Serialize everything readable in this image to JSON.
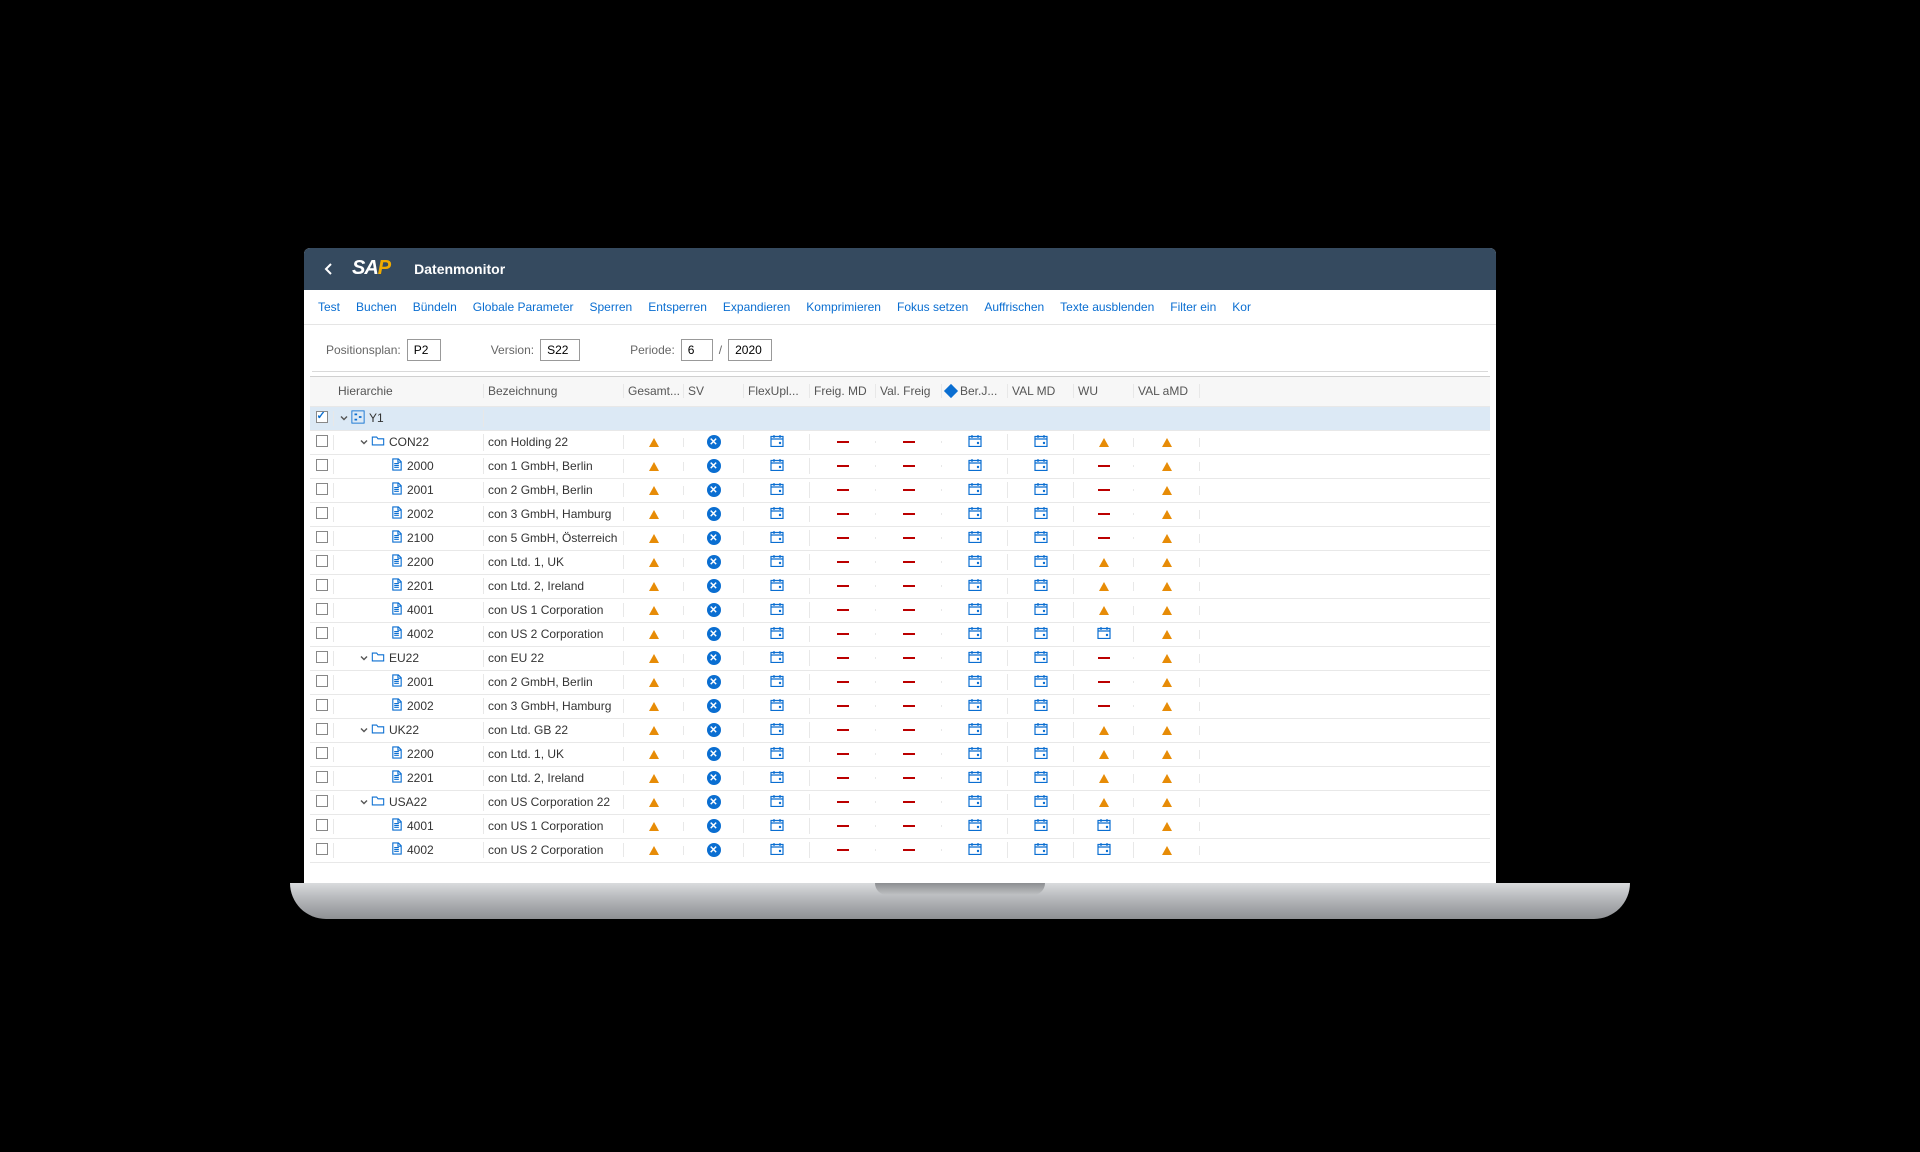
{
  "header": {
    "title": "Datenmonitor",
    "logo": "SAP"
  },
  "toolbar": [
    "Test",
    "Buchen",
    "Bündeln",
    "Globale Parameter",
    "Sperren",
    "Entsperren",
    "Expandieren",
    "Komprimieren",
    "Fokus setzen",
    "Auffrischen",
    "Texte ausblenden",
    "Filter ein",
    "Kor"
  ],
  "filters": {
    "positionsplan_label": "Positionsplan:",
    "positionsplan": "P2",
    "version_label": "Version:",
    "version": "S22",
    "periode_label": "Periode:",
    "periode_m": "6",
    "periode_y": "2020"
  },
  "columns": [
    "Hierarchie",
    "Bezeichnung",
    "Gesamt...",
    "SV",
    "FlexUpl...",
    "Freig. MD",
    "Val. Freig",
    "Ber.J...",
    "VAL MD",
    "WU",
    "VAL aMD"
  ],
  "rows": [
    {
      "lvl": 0,
      "chk": true,
      "exp": true,
      "ico": "tree",
      "code": "Y1",
      "bez": "",
      "g": "",
      "sv": "",
      "fu": "",
      "fm": "",
      "vf": "",
      "bj": "",
      "vm": "",
      "wu": "",
      "va": ""
    },
    {
      "lvl": 1,
      "chk": false,
      "exp": true,
      "ico": "folder",
      "code": "CON22",
      "bez": "con Holding 22",
      "g": "tri",
      "sv": "x",
      "fu": "cal",
      "fm": "dash",
      "vf": "dash",
      "bj": "cal",
      "vm": "cal",
      "wu": "tri",
      "va": "tri"
    },
    {
      "lvl": 2,
      "chk": false,
      "exp": false,
      "ico": "doc",
      "code": "2000",
      "bez": "con 1 GmbH, Berlin",
      "g": "tri",
      "sv": "x",
      "fu": "cal",
      "fm": "dash",
      "vf": "dash",
      "bj": "cal",
      "vm": "cal",
      "wu": "dash",
      "va": "tri"
    },
    {
      "lvl": 2,
      "chk": false,
      "exp": false,
      "ico": "doc",
      "code": "2001",
      "bez": "con 2 GmbH, Berlin",
      "g": "tri",
      "sv": "x",
      "fu": "cal",
      "fm": "dash",
      "vf": "dash",
      "bj": "cal",
      "vm": "cal",
      "wu": "dash",
      "va": "tri"
    },
    {
      "lvl": 2,
      "chk": false,
      "exp": false,
      "ico": "doc",
      "code": "2002",
      "bez": "con 3 GmbH, Hamburg",
      "g": "tri",
      "sv": "x",
      "fu": "cal",
      "fm": "dash",
      "vf": "dash",
      "bj": "cal",
      "vm": "cal",
      "wu": "dash",
      "va": "tri"
    },
    {
      "lvl": 2,
      "chk": false,
      "exp": false,
      "ico": "doc",
      "code": "2100",
      "bez": "con 5 GmbH, Österreich",
      "g": "tri",
      "sv": "x",
      "fu": "cal",
      "fm": "dash",
      "vf": "dash",
      "bj": "cal",
      "vm": "cal",
      "wu": "dash",
      "va": "tri"
    },
    {
      "lvl": 2,
      "chk": false,
      "exp": false,
      "ico": "doc",
      "code": "2200",
      "bez": "con Ltd. 1, UK",
      "g": "tri",
      "sv": "x",
      "fu": "cal",
      "fm": "dash",
      "vf": "dash",
      "bj": "cal",
      "vm": "cal",
      "wu": "tri",
      "va": "tri"
    },
    {
      "lvl": 2,
      "chk": false,
      "exp": false,
      "ico": "doc",
      "code": "2201",
      "bez": "con Ltd. 2, Ireland",
      "g": "tri",
      "sv": "x",
      "fu": "cal",
      "fm": "dash",
      "vf": "dash",
      "bj": "cal",
      "vm": "cal",
      "wu": "tri",
      "va": "tri"
    },
    {
      "lvl": 2,
      "chk": false,
      "exp": false,
      "ico": "doc",
      "code": "4001",
      "bez": "con US 1 Corporation",
      "g": "tri",
      "sv": "x",
      "fu": "cal",
      "fm": "dash",
      "vf": "dash",
      "bj": "cal",
      "vm": "cal",
      "wu": "tri",
      "va": "tri"
    },
    {
      "lvl": 2,
      "chk": false,
      "exp": false,
      "ico": "doc",
      "code": "4002",
      "bez": "con US 2 Corporation",
      "g": "tri",
      "sv": "x",
      "fu": "cal",
      "fm": "dash",
      "vf": "dash",
      "bj": "cal",
      "vm": "cal",
      "wu": "cal",
      "va": "tri"
    },
    {
      "lvl": 1,
      "chk": false,
      "exp": true,
      "ico": "folder",
      "code": "EU22",
      "bez": "con EU 22",
      "g": "tri",
      "sv": "x",
      "fu": "cal",
      "fm": "dash",
      "vf": "dash",
      "bj": "cal",
      "vm": "cal",
      "wu": "dash",
      "va": "tri"
    },
    {
      "lvl": 2,
      "chk": false,
      "exp": false,
      "ico": "doc",
      "code": "2001",
      "bez": "con 2 GmbH, Berlin",
      "g": "tri",
      "sv": "x",
      "fu": "cal",
      "fm": "dash",
      "vf": "dash",
      "bj": "cal",
      "vm": "cal",
      "wu": "dash",
      "va": "tri"
    },
    {
      "lvl": 2,
      "chk": false,
      "exp": false,
      "ico": "doc",
      "code": "2002",
      "bez": "con 3 GmbH, Hamburg",
      "g": "tri",
      "sv": "x",
      "fu": "cal",
      "fm": "dash",
      "vf": "dash",
      "bj": "cal",
      "vm": "cal",
      "wu": "dash",
      "va": "tri"
    },
    {
      "lvl": 1,
      "chk": false,
      "exp": true,
      "ico": "folder",
      "code": "UK22",
      "bez": "con Ltd. GB 22",
      "g": "tri",
      "sv": "x",
      "fu": "cal",
      "fm": "dash",
      "vf": "dash",
      "bj": "cal",
      "vm": "cal",
      "wu": "tri",
      "va": "tri"
    },
    {
      "lvl": 2,
      "chk": false,
      "exp": false,
      "ico": "doc",
      "code": "2200",
      "bez": "con Ltd. 1, UK",
      "g": "tri",
      "sv": "x",
      "fu": "cal",
      "fm": "dash",
      "vf": "dash",
      "bj": "cal",
      "vm": "cal",
      "wu": "tri",
      "va": "tri"
    },
    {
      "lvl": 2,
      "chk": false,
      "exp": false,
      "ico": "doc",
      "code": "2201",
      "bez": "con Ltd. 2, Ireland",
      "g": "tri",
      "sv": "x",
      "fu": "cal",
      "fm": "dash",
      "vf": "dash",
      "bj": "cal",
      "vm": "cal",
      "wu": "tri",
      "va": "tri"
    },
    {
      "lvl": 1,
      "chk": false,
      "exp": true,
      "ico": "folder",
      "code": "USA22",
      "bez": "con US Corporation 22",
      "g": "tri",
      "sv": "x",
      "fu": "cal",
      "fm": "dash",
      "vf": "dash",
      "bj": "cal",
      "vm": "cal",
      "wu": "tri",
      "va": "tri"
    },
    {
      "lvl": 2,
      "chk": false,
      "exp": false,
      "ico": "doc",
      "code": "4001",
      "bez": "con US 1 Corporation",
      "g": "tri",
      "sv": "x",
      "fu": "cal",
      "fm": "dash",
      "vf": "dash",
      "bj": "cal",
      "vm": "cal",
      "wu": "cal",
      "va": "tri"
    },
    {
      "lvl": 2,
      "chk": false,
      "exp": false,
      "ico": "doc",
      "code": "4002",
      "bez": "con US 2 Corporation",
      "g": "tri",
      "sv": "x",
      "fu": "cal",
      "fm": "dash",
      "vf": "dash",
      "bj": "cal",
      "vm": "cal",
      "wu": "cal",
      "va": "tri"
    }
  ]
}
